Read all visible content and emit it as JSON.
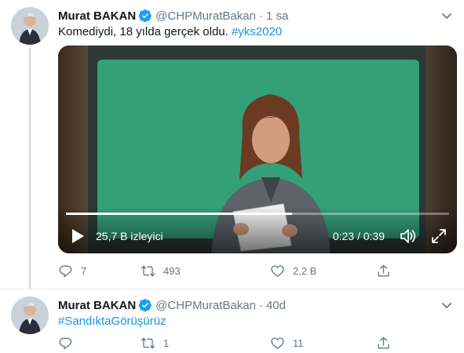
{
  "tweets": [
    {
      "author_name": "Murat BAKAN",
      "handle": "@CHPMuratBakan",
      "separator": "·",
      "time": "1 sa",
      "text_plain": "Komediydi, 18 yılda gerçek oldu. ",
      "hashtag": "#yks2020",
      "video": {
        "views": "25,7 B izleyici",
        "time_display": "0:23 / 0:39",
        "progress_fraction": 0.59
      },
      "actions": {
        "reply_count": "7",
        "retweet_count": "493",
        "like_count": "2,2 B",
        "share_count": ""
      }
    },
    {
      "author_name": "Murat BAKAN",
      "handle": "@CHPMuratBakan",
      "separator": "·",
      "time": "40d",
      "text_plain": "",
      "hashtag": "#SandıktaGörüşürüz",
      "actions": {
        "reply_count": "",
        "retweet_count": "1",
        "like_count": "11",
        "share_count": ""
      }
    }
  ],
  "icons": {
    "verified": "verified-badge-icon",
    "caret": "chevron-down-icon",
    "reply": "reply-icon",
    "retweet": "retweet-icon",
    "like": "heart-icon",
    "share": "share-icon",
    "play": "play-icon",
    "volume": "volume-icon",
    "fullscreen": "fullscreen-icon"
  },
  "colors": {
    "verified": "#1da1f2",
    "link": "#1b95e0",
    "secondary_text": "#657786",
    "thread_line": "#ccd6dd"
  }
}
